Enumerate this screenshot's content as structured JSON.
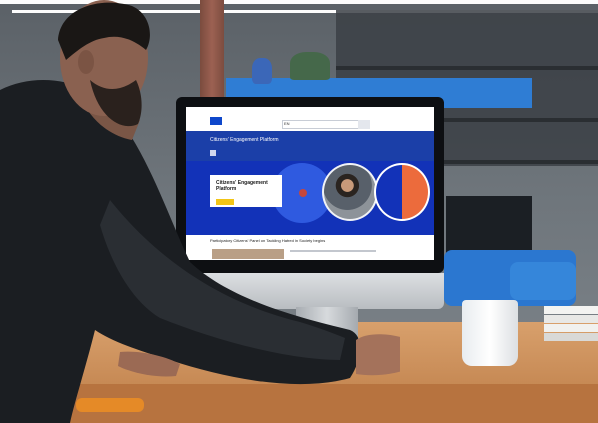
{
  "scene": {
    "description_ignored": ""
  },
  "website": {
    "logo_text": "",
    "language": "EN",
    "site_title": "Citizens' Engagement Platform",
    "site_subtitle": "",
    "hero_card_title": "Citizens' Engagement Platform",
    "hero_card_text": "",
    "hero_button_label": "",
    "section_title": "Participatory Citizens' Panel on Tackling Hatred in Society begins"
  },
  "colors": {
    "eu_blue": "#0e47cb",
    "hero_blue": "#1232b8",
    "accent_orange": "#ec6b3c",
    "button_yellow": "#f2c516"
  }
}
